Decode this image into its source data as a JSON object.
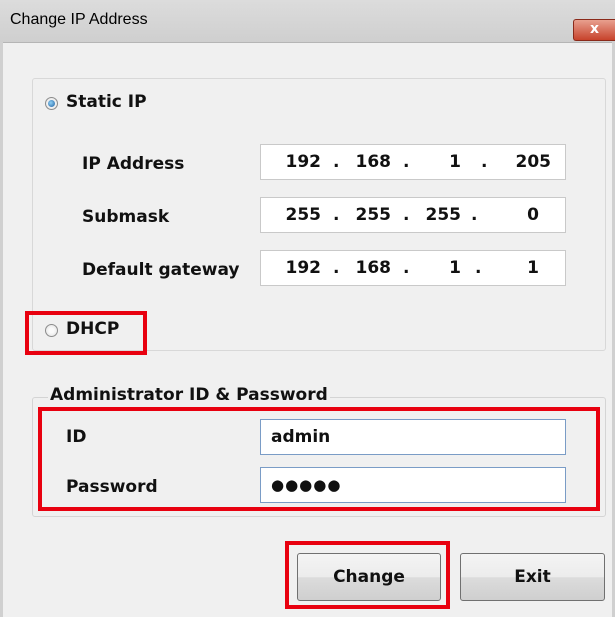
{
  "window": {
    "title": "Change IP Address",
    "close_symbol": "x"
  },
  "static_ip": {
    "label": "Static IP",
    "selected": true,
    "fields": [
      {
        "label": "IP Address",
        "octets": [
          "192",
          "168",
          "1",
          "205"
        ]
      },
      {
        "label": "Submask",
        "octets": [
          "255",
          "255",
          "255",
          "0"
        ]
      },
      {
        "label": "Default gateway",
        "octets": [
          "192",
          "168",
          "1",
          "1"
        ]
      }
    ]
  },
  "dhcp": {
    "label": "DHCP",
    "selected": false
  },
  "admin": {
    "group_label": "Administrator ID & Password",
    "id_label": "ID",
    "id_value": "admin",
    "password_label": "Password",
    "password_value": "●●●●●"
  },
  "buttons": {
    "change": "Change",
    "exit": "Exit"
  },
  "colors": {
    "highlight": "#e8000f",
    "window_bg": "#f0f0f0",
    "close_red": "#c7432c"
  }
}
